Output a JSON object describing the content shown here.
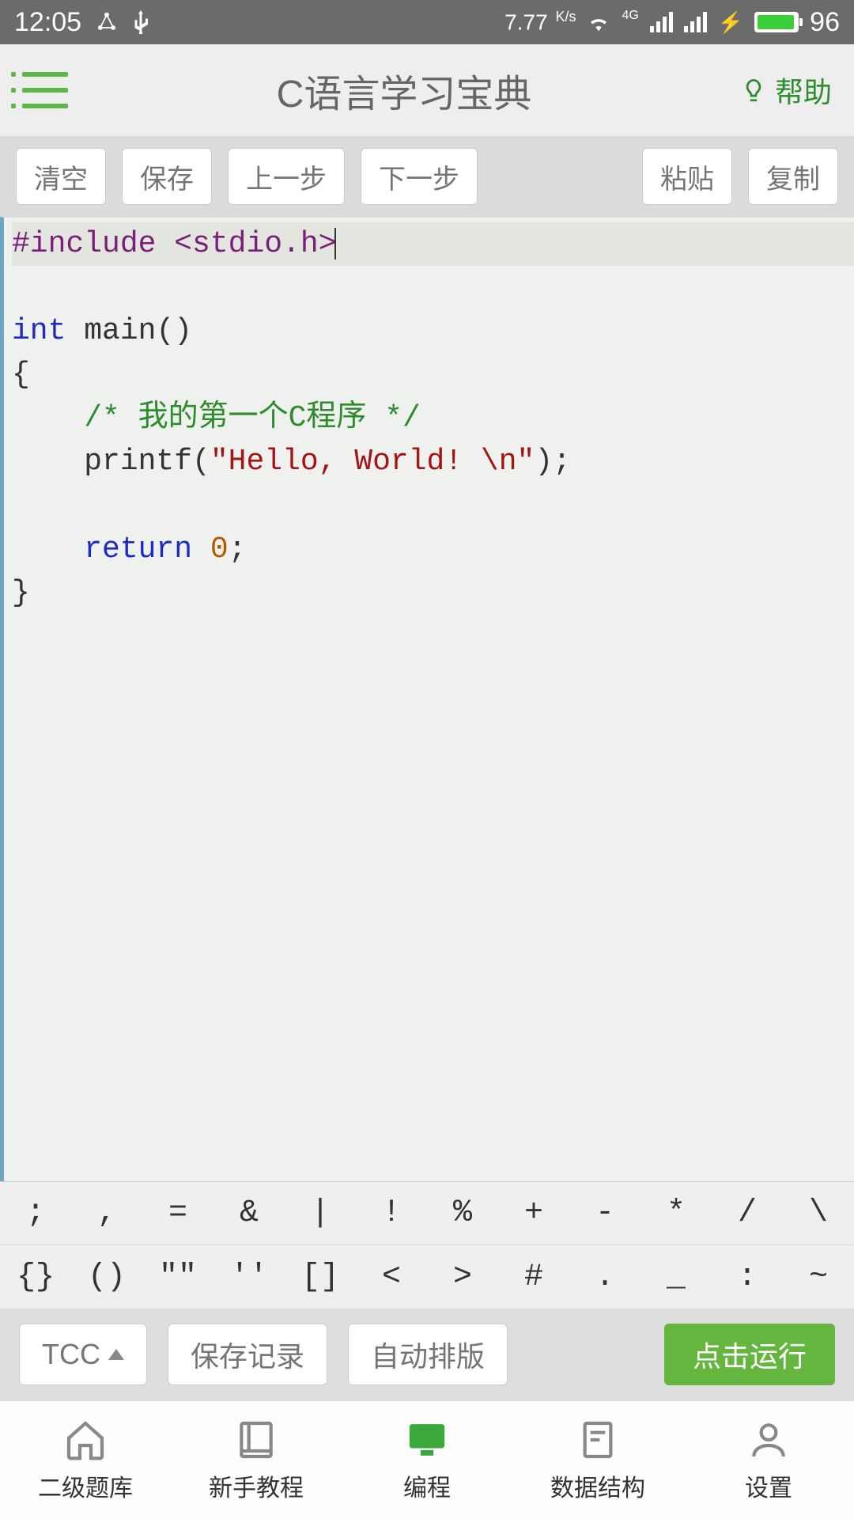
{
  "status": {
    "time": "12:05",
    "speed": "7.77",
    "speed_unit": "K/s",
    "net_label": "4G",
    "battery": "96"
  },
  "header": {
    "title": "C语言学习宝典",
    "help": "帮助"
  },
  "toolbar": {
    "clear": "清空",
    "save": "保存",
    "prev": "上一步",
    "next": "下一步",
    "paste": "粘贴",
    "copy": "复制"
  },
  "code": {
    "line1_prep": "#include <stdio.h>",
    "line3_kw": "int",
    "line3_rest": " main()",
    "line4": "{",
    "line5_cm": "    /* 我的第一个C程序 */",
    "line6a": "    printf(",
    "line6_str": "\"Hello, World! \\n\"",
    "line6b": ");",
    "line8a": "    ",
    "line8_kw": "return",
    "line8b": " ",
    "line8_num": "0",
    "line8c": ";",
    "line9": "}"
  },
  "symbols": {
    "row1": [
      ";",
      ",",
      "=",
      "&",
      "|",
      "!",
      "%",
      "+",
      "-",
      "*",
      "/",
      "\\"
    ],
    "row2": [
      "{}",
      "()",
      "\"\"",
      "''",
      "[]",
      "<",
      ">",
      "#",
      ".",
      "_",
      ":",
      "~"
    ]
  },
  "bottom": {
    "compiler": "TCC",
    "save_record": "保存记录",
    "auto_format": "自动排版",
    "run": "点击运行"
  },
  "nav": {
    "item1": "二级题库",
    "item2": "新手教程",
    "item3": "编程",
    "item4": "数据结构",
    "item5": "设置"
  }
}
